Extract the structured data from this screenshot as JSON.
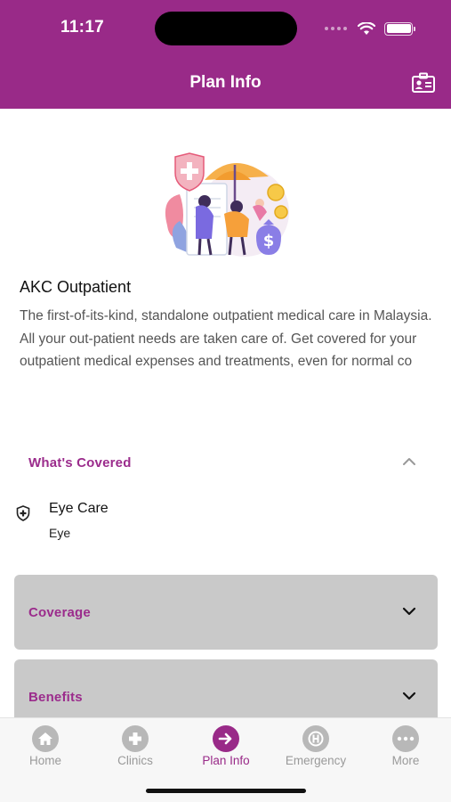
{
  "status_bar": {
    "time": "11:17"
  },
  "header": {
    "title": "Plan Info",
    "action_icon": "id-card-icon"
  },
  "plan": {
    "name": "AKC Outpatient",
    "description": "The first-of-its-kind, standalone outpatient medical care in Malaysia. All your out-patient needs are taken care of. Get covered for your outpatient medical expenses and treatments, even for normal co"
  },
  "covered_section": {
    "label": "What's Covered",
    "expanded": true,
    "items": [
      {
        "title": "Eye Care",
        "subtitle": "Eye",
        "icon": "shield-plus-icon"
      }
    ]
  },
  "accordions": [
    {
      "label": "Coverage",
      "expanded": false
    },
    {
      "label": "Benefits",
      "expanded": false
    }
  ],
  "tabs": [
    {
      "label": "Home",
      "icon": "home-icon",
      "active": false
    },
    {
      "label": "Clinics",
      "icon": "plus-icon",
      "active": false
    },
    {
      "label": "Plan Info",
      "icon": "arrow-right-icon",
      "active": true
    },
    {
      "label": "Emergency",
      "icon": "hospital-icon",
      "active": false
    },
    {
      "label": "More",
      "icon": "more-dots-icon",
      "active": false
    }
  ],
  "colors": {
    "brand": "#992a88",
    "accent_text": "#9b2c8c",
    "accordion_bg": "#c9c9c9"
  }
}
